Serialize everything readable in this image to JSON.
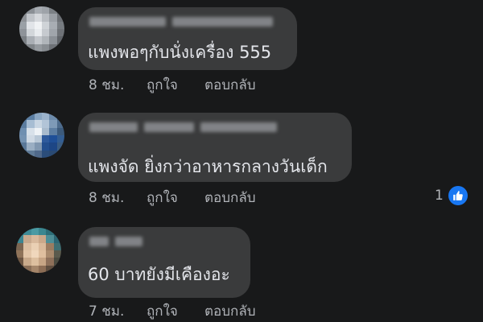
{
  "comments": [
    {
      "author": "",
      "text": "แพงพอๆกับนั่งเครื่อง 555",
      "time": "8 ชม.",
      "like_label": "ถูกใจ",
      "reply_label": "ตอบกลับ",
      "reactions": ""
    },
    {
      "author": "",
      "text": "แพงจัด ยิ่งกว่าอาหารกลางวันเด็ก",
      "time": "8 ชม.",
      "like_label": "ถูกใจ",
      "reply_label": "ตอบกลับ",
      "reactions": "1"
    },
    {
      "author": "",
      "text": "60 บาทยังมีเคืองอะ",
      "time": "7 ชม.",
      "like_label": "ถูกใจ",
      "reply_label": "ตอบกลับ",
      "reactions": ""
    }
  ],
  "colors": {
    "background": "#18191a",
    "bubble": "#3a3b3c",
    "text_primary": "#e4e6eb",
    "text_secondary": "#b0b3b8",
    "accent": "#1877f2"
  },
  "icons": {
    "reaction": "thumbs-up-icon"
  }
}
